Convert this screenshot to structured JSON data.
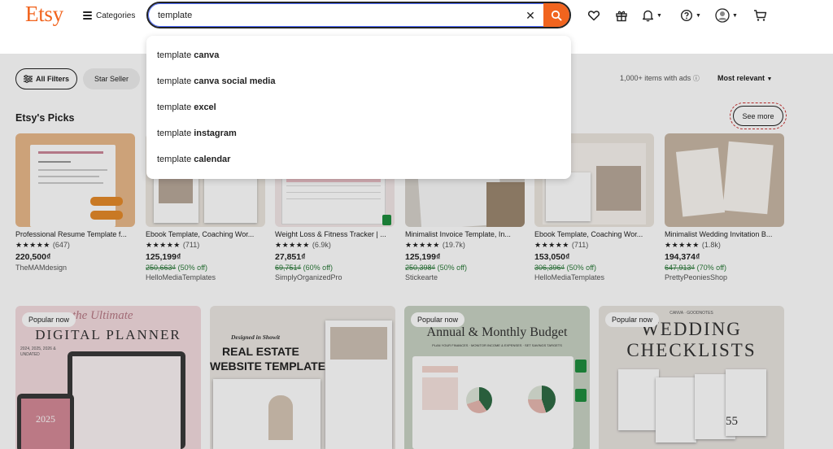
{
  "brand": {
    "logo": "Etsy",
    "accent": "#f1641e"
  },
  "header": {
    "categories_label": "Categories",
    "search_value": "template",
    "icons": [
      "heart-icon",
      "gift-icon",
      "bell-icon",
      "help-icon",
      "avatar",
      "cart-icon"
    ]
  },
  "suggestions": [
    {
      "prefix": "template",
      "completion": "canva"
    },
    {
      "prefix": "template",
      "completion": "canva social media"
    },
    {
      "prefix": "template",
      "completion": "excel"
    },
    {
      "prefix": "template",
      "completion": "instagram"
    },
    {
      "prefix": "template",
      "completion": "calendar"
    }
  ],
  "filters": {
    "all_filters": "All Filters",
    "star_seller": "Star Seller",
    "result_count": "1,000+ items with ads",
    "sort": "Most relevant"
  },
  "picks": {
    "title": "Etsy's Picks",
    "see_more": "See more",
    "items": [
      {
        "title": "Professional Resume Template f...",
        "rating": "★★★★★",
        "count": "(647)",
        "price": "220,500₫",
        "original": "",
        "discount": "",
        "shop": "TheMAMdesign"
      },
      {
        "title": "Ebook Template, Coaching Wor...",
        "rating": "★★★★★",
        "count": "(711)",
        "price": "125,199₫",
        "original": "250,663₫",
        "discount": "(50% off)",
        "shop": "HelloMediaTemplates"
      },
      {
        "title": "Weight Loss & Fitness Tracker | ...",
        "rating": "★★★★★",
        "count": "(6.9k)",
        "price": "27,851₫",
        "original": "69,751₫",
        "discount": "(60% off)",
        "shop": "SimplyOrganizedPro"
      },
      {
        "title": "Minimalist Invoice Template, In...",
        "rating": "★★★★★",
        "count": "(19.7k)",
        "price": "125,199₫",
        "original": "250,398₫",
        "discount": "(50% off)",
        "shop": "Stickearte"
      },
      {
        "title": "Ebook Template, Coaching Wor...",
        "rating": "★★★★★",
        "count": "(711)",
        "price": "153,050₫",
        "original": "306,396₫",
        "discount": "(50% off)",
        "shop": "HelloMediaTemplates"
      },
      {
        "title": "Minimalist Wedding Invitation B...",
        "rating": "★★★★★",
        "count": "(1.8k)",
        "price": "194,374₫",
        "original": "647,913₫",
        "discount": "(70% off)",
        "shop": "PrettyPeoniesShop"
      }
    ]
  },
  "popular": {
    "badge": "Popular now",
    "cards": [
      {
        "heading1": "the Ultimate",
        "heading2": "DIGITAL PLANNER",
        "sub": "2024, 2025, 2026 & UNDATED",
        "year": "2025"
      },
      {
        "heading1": "Designed in Showit",
        "heading2": "REAL ESTATE",
        "heading3": "WEBSITE TEMPLATE"
      },
      {
        "heading1": "Annual & Monthly Budget",
        "sub": "PLAN YOUR FINANCES · MONITOR INCOME & EXPENSES · SET SAVINGS TARGETS"
      },
      {
        "heading1": "WEDDING",
        "heading2": "CHECKLISTS",
        "sub": "CANVA · GOODNOTES",
        "count": "55"
      }
    ]
  }
}
